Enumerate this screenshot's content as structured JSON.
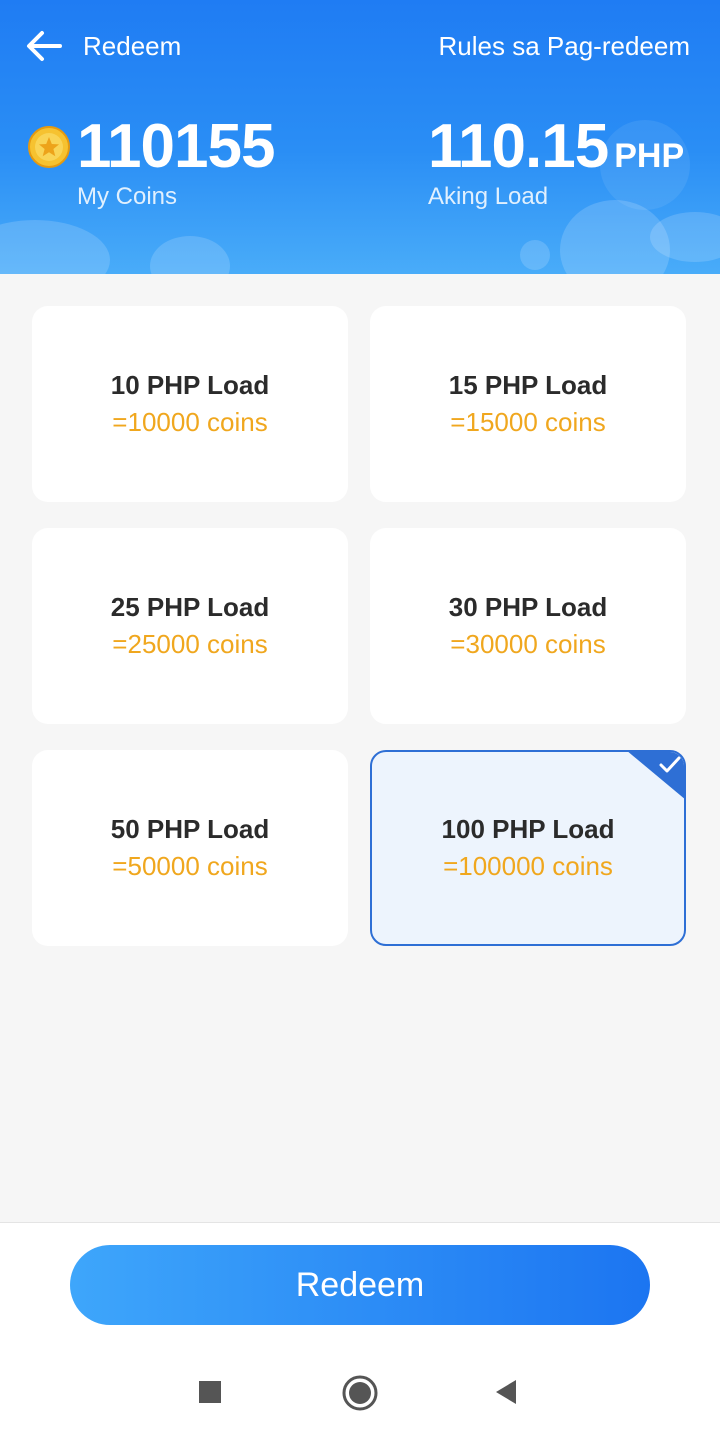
{
  "header": {
    "title": "Redeem",
    "rules_label": "Rules sa Pag-redeem",
    "coins_value": "110155",
    "coins_label": "My Coins",
    "load_value": "110.15",
    "load_unit": "PHP",
    "load_label": "Aking Load"
  },
  "options": [
    {
      "name": "10 PHP Load",
      "cost": "=10000 coins",
      "selected": false
    },
    {
      "name": "15 PHP Load",
      "cost": "=15000 coins",
      "selected": false
    },
    {
      "name": "25 PHP Load",
      "cost": "=25000 coins",
      "selected": false
    },
    {
      "name": "30 PHP Load",
      "cost": "=30000 coins",
      "selected": false
    },
    {
      "name": "50 PHP Load",
      "cost": "=50000 coins",
      "selected": false
    },
    {
      "name": "100 PHP Load",
      "cost": "=100000 coins",
      "selected": true
    }
  ],
  "redeem_button": "Redeem",
  "icons": {
    "back": "arrow-left-icon",
    "coin": "gold-coin-star-icon",
    "selected_check": "checkmark-icon",
    "nav_recent": "square-icon",
    "nav_home": "circle-icon",
    "nav_back": "triangle-back-icon"
  },
  "colors": {
    "header_blue": "#1f7cf3",
    "accent_orange": "#f0a71e",
    "selected_border": "#2e6fd5"
  }
}
